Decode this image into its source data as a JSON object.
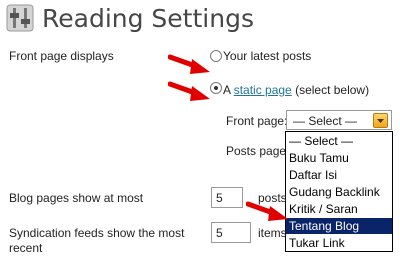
{
  "header": {
    "title": "Reading Settings",
    "icon": "reading-settings-icon"
  },
  "front_page": {
    "label": "Front page displays",
    "options": [
      {
        "label": "Your latest posts",
        "checked": false
      },
      {
        "prefix": "A ",
        "link": "static page",
        "suffix": " (select below)",
        "checked": true
      }
    ],
    "front_page_label": "Front page:",
    "posts_page_label": "Posts page:",
    "front_page_select": {
      "selected": "— Select —"
    }
  },
  "dropdown": {
    "options": [
      "— Select —",
      "Buku Tamu",
      "Daftar Isi",
      "Gudang Backlink",
      "Kritik / Saran",
      "Tentang Blog",
      "Tukar Link"
    ],
    "highlighted": "Tentang Blog"
  },
  "blog_pages": {
    "label": "Blog pages show at most",
    "value": "5",
    "unit": "posts"
  },
  "syndication": {
    "label_line1": "Syndication feeds show the most",
    "label_line2": "recent",
    "value": "5",
    "unit": "items"
  },
  "colors": {
    "accent": "#21759b",
    "highlight": "#0a246a",
    "annotation": "#e00000"
  }
}
